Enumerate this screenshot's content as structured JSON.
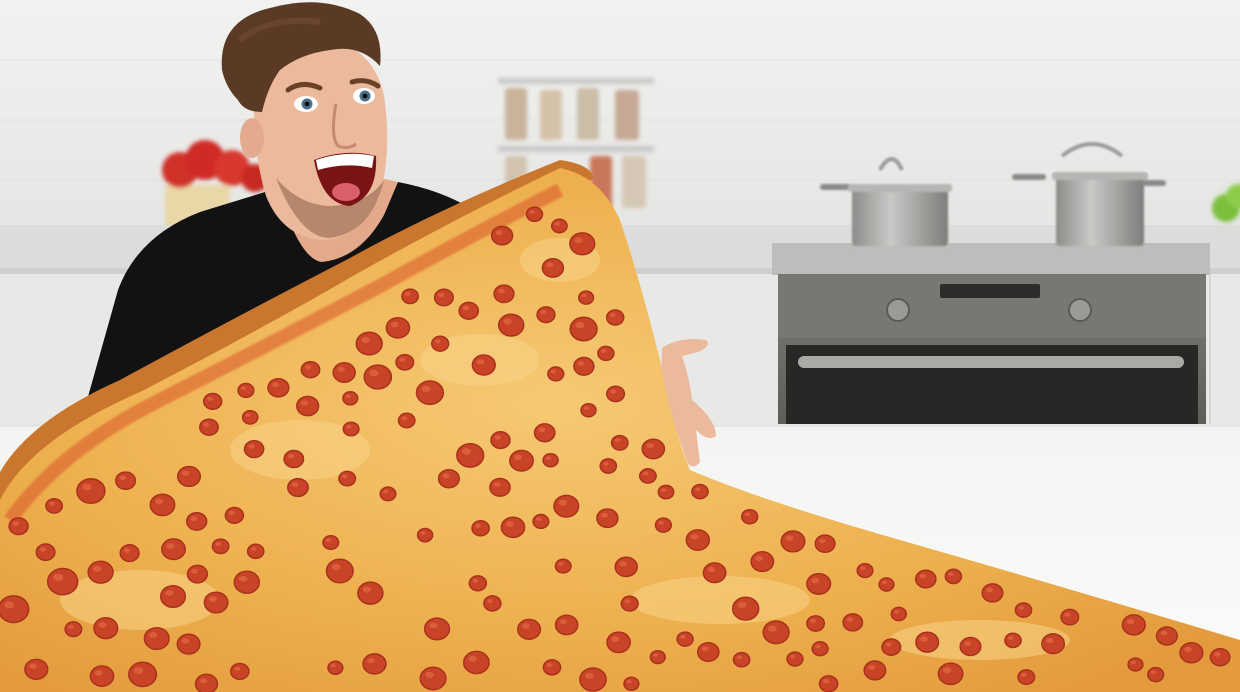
{
  "scene": {
    "colors": {
      "wall": "#ededec",
      "tile_line": "#e1e1df",
      "counter_back": "#dcdcda",
      "cabinet": "#e9e9e7",
      "table": "#f7f7f6",
      "oven_body": "#6f6f6c",
      "oven_window": "#2a2a28",
      "shirt": "#121212",
      "hair": "#5a3a24",
      "skin": "#e9b79a",
      "crust": "#c9762e",
      "cheese": "#eeb04e",
      "cheese_light": "#f6c974",
      "sauce": "#d9552c",
      "pepperoni": "#c94427",
      "pepperoni_dark": "#a8321c",
      "pot": "#a4a4a2",
      "flowers": "#d0322a"
    },
    "objects": [
      "person",
      "giant-pizza-slice",
      "pepperoni",
      "oven",
      "cooking-pots",
      "spice-rack",
      "red-flowers",
      "green-plant",
      "white-table"
    ]
  }
}
